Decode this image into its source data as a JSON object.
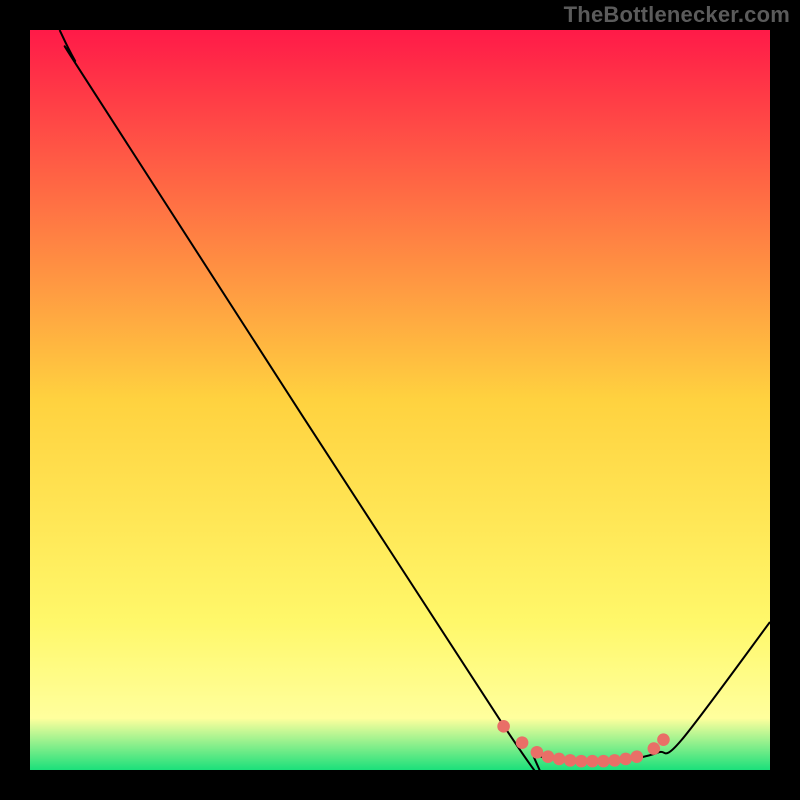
{
  "watermark": "TheBottlenecker.com",
  "chart_data": {
    "type": "line",
    "title": "",
    "xlabel": "",
    "ylabel": "",
    "xlim": [
      0,
      100
    ],
    "ylim": [
      0,
      100
    ],
    "background_gradient": {
      "type": "linear-vertical",
      "stops": [
        {
          "offset": 0.0,
          "color": "#ff1a48"
        },
        {
          "offset": 0.5,
          "color": "#ffd23f"
        },
        {
          "offset": 0.8,
          "color": "#fff86a"
        },
        {
          "offset": 0.93,
          "color": "#ffff9d"
        },
        {
          "offset": 1.0,
          "color": "#1be07b"
        }
      ]
    },
    "series": [
      {
        "name": "bottleneck-curve",
        "stroke": "#000000",
        "points": [
          {
            "x": 4.0,
            "y": 100.0
          },
          {
            "x": 6.0,
            "y": 96.0
          },
          {
            "x": 10.0,
            "y": 89.5
          },
          {
            "x": 64.0,
            "y": 6.0
          },
          {
            "x": 68.0,
            "y": 2.4
          },
          {
            "x": 70.0,
            "y": 1.6
          },
          {
            "x": 73.0,
            "y": 1.2
          },
          {
            "x": 78.0,
            "y": 1.2
          },
          {
            "x": 82.0,
            "y": 1.6
          },
          {
            "x": 85.0,
            "y": 2.4
          },
          {
            "x": 88.0,
            "y": 4.0
          },
          {
            "x": 100.0,
            "y": 20.0
          }
        ]
      }
    ],
    "markers": {
      "name": "optimal-range-dots",
      "color": "#e96f67",
      "radius_pct": 0.85,
      "points": [
        {
          "x": 64.0,
          "y": 5.9
        },
        {
          "x": 66.5,
          "y": 3.7
        },
        {
          "x": 68.5,
          "y": 2.4
        },
        {
          "x": 70.0,
          "y": 1.8
        },
        {
          "x": 71.5,
          "y": 1.5
        },
        {
          "x": 73.0,
          "y": 1.3
        },
        {
          "x": 74.5,
          "y": 1.2
        },
        {
          "x": 76.0,
          "y": 1.2
        },
        {
          "x": 77.5,
          "y": 1.2
        },
        {
          "x": 79.0,
          "y": 1.3
        },
        {
          "x": 80.5,
          "y": 1.5
        },
        {
          "x": 82.0,
          "y": 1.8
        },
        {
          "x": 84.3,
          "y": 2.9
        },
        {
          "x": 85.6,
          "y": 4.1
        }
      ]
    }
  }
}
